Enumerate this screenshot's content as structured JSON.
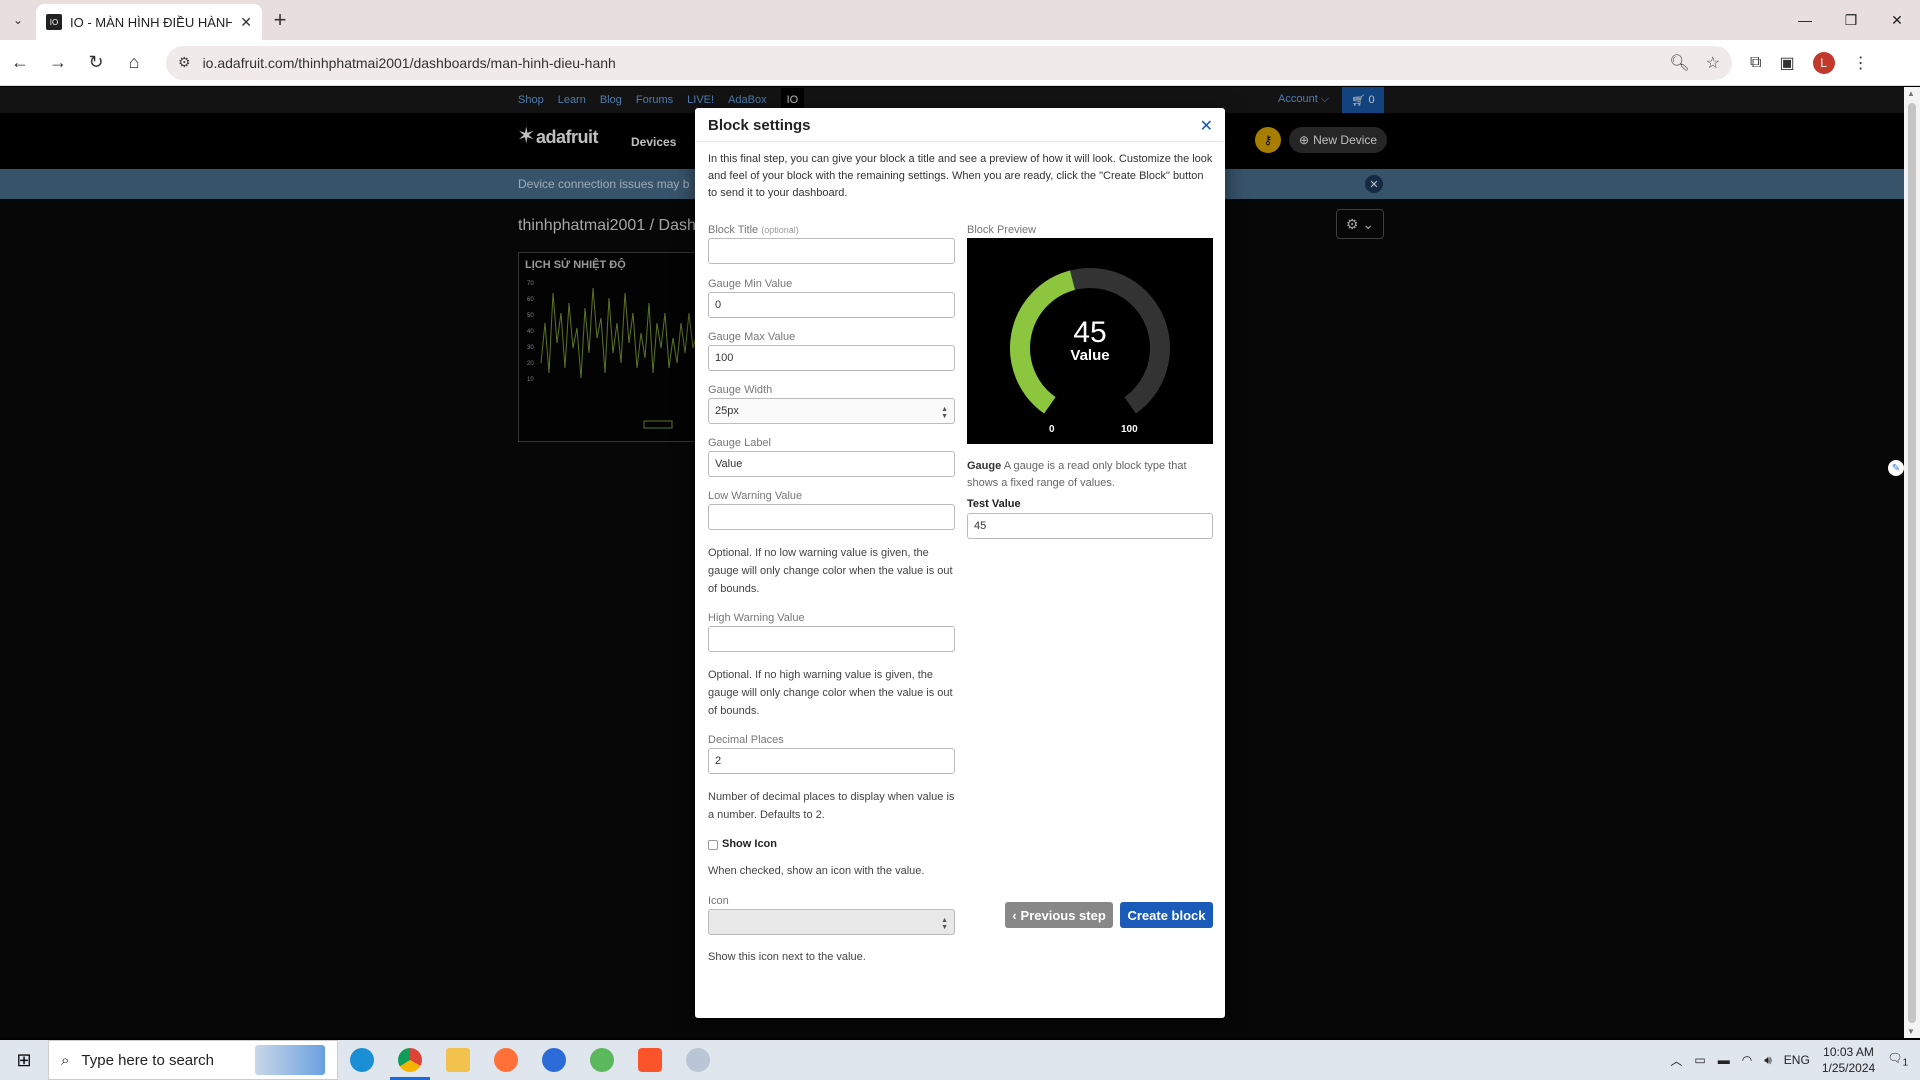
{
  "browser": {
    "tab_title": "IO - MÀN HÌNH ĐIỀU HÀNH",
    "url": "io.adafruit.com/thinhphatmai2001/dashboards/man-hinh-dieu-hanh",
    "profile_initial": "L"
  },
  "site": {
    "topnav": [
      "Shop",
      "Learn",
      "Blog",
      "Forums",
      "LIVE!",
      "AdaBox",
      "IO"
    ],
    "account": "Account ⌵",
    "cart": "0",
    "logo": "adafruit",
    "nav_devices": "Devices",
    "new_device": "New Device",
    "alert": "Device connection issues may b",
    "breadcrumb": "thinhphatmai2001 / Dashb",
    "chart_title": "LỊCH SỬ NHIỆT ĐỘ"
  },
  "modal": {
    "title": "Block settings",
    "intro": "In this final step, you can give your block a title and see a preview of how it will look. Customize the look and feel of your block with the remaining settings. When you are ready, click the \"Create Block\" button to send it to your dashboard.",
    "block_title_label": "Block Title",
    "block_title_optional": "(optional)",
    "block_title_value": "",
    "min_label": "Gauge Min Value",
    "min_value": "0",
    "max_label": "Gauge Max Value",
    "max_value": "100",
    "width_label": "Gauge Width",
    "width_value": "25px",
    "gauge_label_label": "Gauge Label",
    "gauge_label_value": "Value",
    "low_label": "Low Warning Value",
    "low_value": "",
    "low_help": "Optional. If no low warning value is given, the gauge will only change color when the value is out of bounds.",
    "high_label": "High Warning Value",
    "high_value": "",
    "high_help": "Optional. If no high warning value is given, the gauge will only change color when the value is out of bounds.",
    "decimal_label": "Decimal Places",
    "decimal_value": "2",
    "decimal_help": "Number of decimal places to display when value is a number. Defaults to 2.",
    "show_icon_label": "Show Icon",
    "show_icon_help": "When checked, show an icon with the value.",
    "icon_label": "Icon",
    "icon_help": "Show this icon next to the value.",
    "preview_label": "Block Preview",
    "preview": {
      "value": "45",
      "label": "Value",
      "min": "0",
      "max": "100",
      "fraction": 0.45,
      "fill_color": "#8cc63f",
      "track_color": "#333333"
    },
    "gauge_desc_title": "Gauge",
    "gauge_desc": "A gauge is a read only block type that shows a fixed range of values.",
    "test_label": "Test Value",
    "test_value": "45",
    "prev_button": "Previous step",
    "create_button": "Create block"
  },
  "taskbar": {
    "search_placeholder": "Type here to search",
    "lang": "ENG",
    "time": "10:03 AM",
    "date": "1/25/2024",
    "notif_count": "1"
  }
}
